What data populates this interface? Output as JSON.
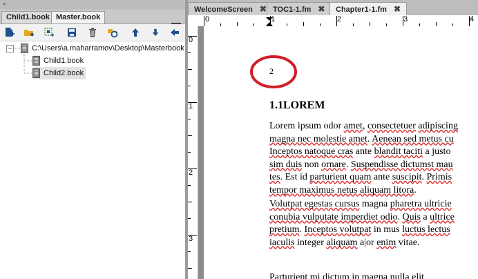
{
  "book_pod": {
    "collapse_glyph": "«",
    "tabs": [
      {
        "label": "Child1.book",
        "active": false
      },
      {
        "label": "Master.book",
        "active": true
      }
    ],
    "toolbar_icons": [
      "add-file-icon",
      "add-folder-icon",
      "add-group-icon",
      "save-icon",
      "delete-icon",
      "update-book-icon",
      "move-up-icon",
      "move-down-icon",
      "move-left-icon"
    ],
    "tree": {
      "root_expander": "−",
      "root_path": "C:\\Users\\a.maharramov\\Desktop\\Masterbook",
      "children": [
        "Child1.book",
        "Child2.book"
      ]
    }
  },
  "document": {
    "tabs": [
      {
        "label": "WelcomeScreen",
        "close": "✖"
      },
      {
        "label": "TOC1-1.fm",
        "close": "✖"
      },
      {
        "label": "Chapter1-1.fm",
        "close": "✖",
        "active": true
      }
    ],
    "hruler_numbers": [
      "0",
      "1",
      "2",
      "3",
      "4"
    ],
    "vruler_numbers": [
      "0",
      "1",
      "2",
      "3"
    ],
    "page_number": "2",
    "heading": "1.1LOREM",
    "annotation_color": "#d01f26"
  }
}
